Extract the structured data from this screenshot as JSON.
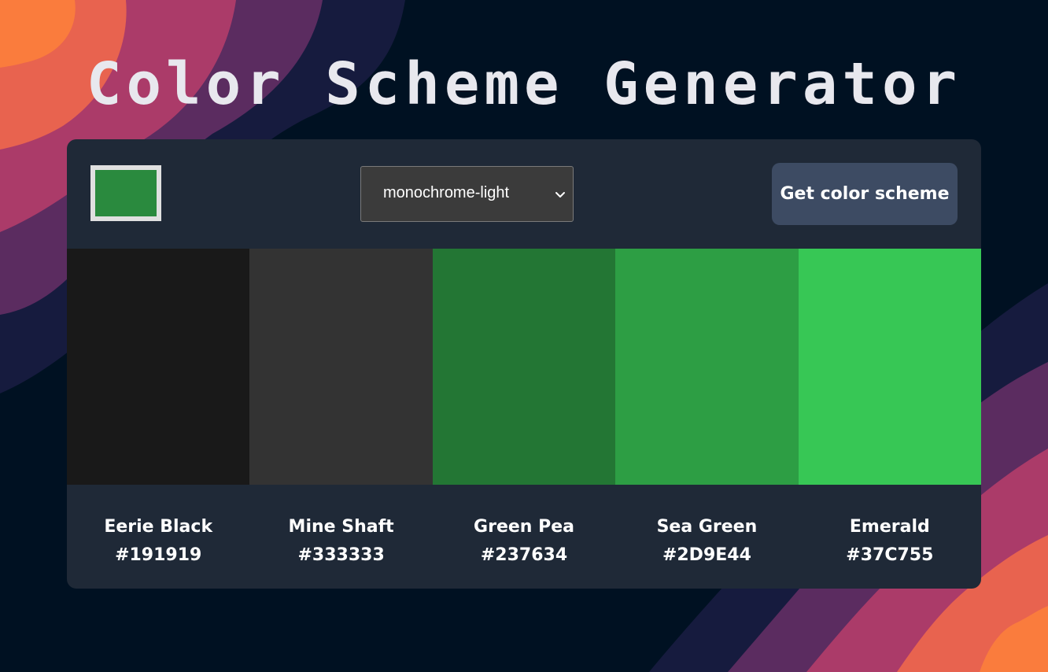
{
  "page": {
    "title": "Color Scheme Generator",
    "background_color": "#001122",
    "title_color": "#e8e8ee"
  },
  "controls": {
    "seed_color": "#2a8a3e",
    "mode_select": {
      "selected": "monochrome-light",
      "icon": "chevron-down-icon"
    },
    "get_button_label": "Get color scheme",
    "card_color": "#1f2937",
    "button_color": "#3d4b63"
  },
  "scheme": [
    {
      "name": "Eerie Black",
      "hex": "#191919"
    },
    {
      "name": "Mine Shaft",
      "hex": "#333333"
    },
    {
      "name": "Green Pea",
      "hex": "#237634"
    },
    {
      "name": "Sea Green",
      "hex": "#2D9E44"
    },
    {
      "name": "Emerald",
      "hex": "#37C755"
    }
  ]
}
